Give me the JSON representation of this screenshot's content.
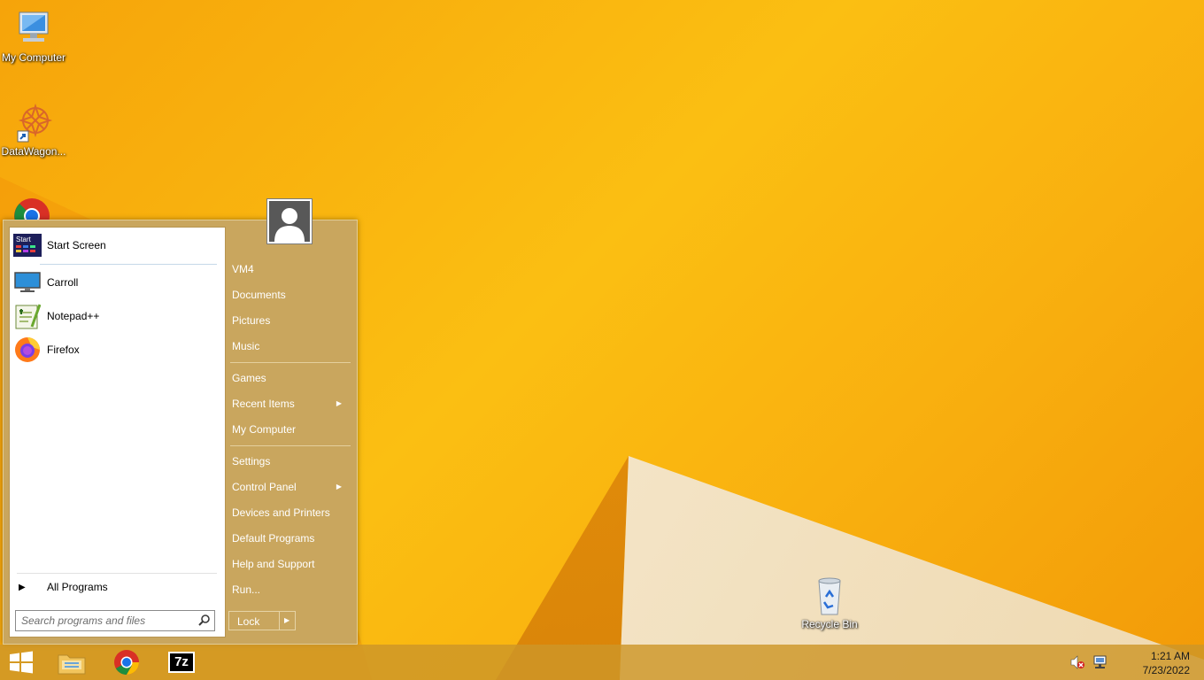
{
  "desktop": {
    "icons": [
      {
        "name": "My Computer"
      },
      {
        "name": "DataWagon..."
      },
      {
        "name": "Recycle Bin"
      }
    ]
  },
  "start_menu": {
    "pinned": [
      {
        "label": "Start Screen",
        "icon": "start-screen-icon"
      },
      {
        "label": "Carroll",
        "icon": "monitor-icon"
      },
      {
        "label": "Notepad++",
        "icon": "notepad-plus-plus-icon"
      },
      {
        "label": "Firefox",
        "icon": "firefox-icon"
      }
    ],
    "all_programs": "All Programs",
    "search": {
      "placeholder": "Search programs and files"
    },
    "right": {
      "group1": [
        "VM4",
        "Documents",
        "Pictures",
        "Music"
      ],
      "group2": [
        "Games",
        "Recent Items",
        "My Computer"
      ],
      "group3": [
        "Settings",
        "Control Panel",
        "Devices and Printers",
        "Default Programs",
        "Help and Support",
        "Run..."
      ]
    },
    "lock_label": "Lock",
    "start_icon_text": "Start"
  },
  "taskbar": {
    "pinned": [
      "start-button",
      "file-explorer",
      "chrome",
      "7-zip"
    ],
    "seven_zip_text": "7z",
    "clock": {
      "time": "1:21 AM",
      "date": "7/23/2022"
    }
  },
  "colors": {
    "menu_bg": "#c9a65e",
    "wallpaper": "#fbbf12"
  }
}
